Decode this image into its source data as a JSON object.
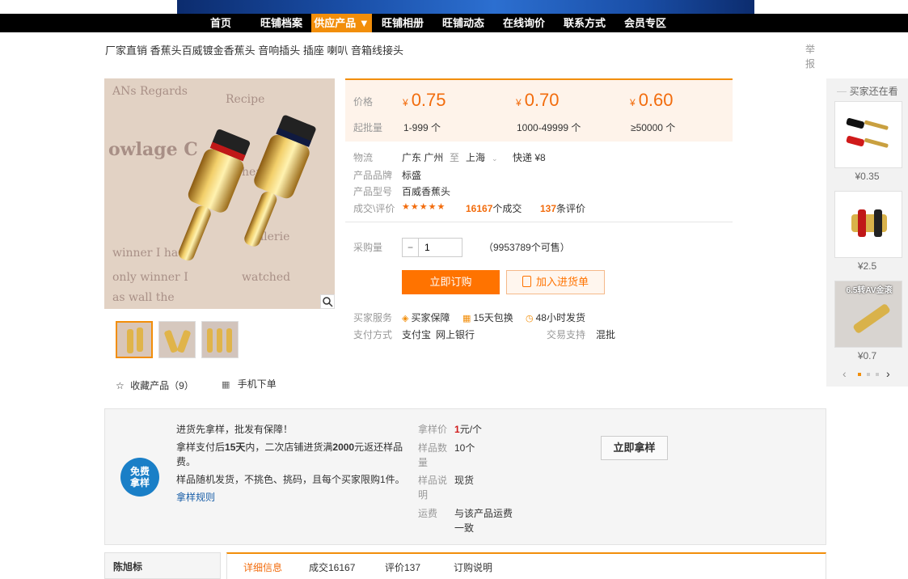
{
  "nav": {
    "items": [
      {
        "label": "首页"
      },
      {
        "label": "旺铺档案"
      },
      {
        "label": "供应产品 ▼"
      },
      {
        "label": "旺铺相册"
      },
      {
        "label": "旺铺动态"
      },
      {
        "label": "在线询价"
      },
      {
        "label": "联系方式"
      },
      {
        "label": "会员专区"
      }
    ],
    "active_index": 2,
    "active_color": "#f28e0a"
  },
  "product": {
    "title": "厂家直销 香蕉头百威镀金香蕉头 音响插头 插座 喇叭 音箱线接头",
    "report_label": "举报"
  },
  "pricing": {
    "price_label": "价格",
    "moq_label": "起批量",
    "currency": "¥",
    "tiers": [
      {
        "price": "0.75",
        "qty": "1-999 个"
      },
      {
        "price": "0.70",
        "qty": "1000-49999 个"
      },
      {
        "price": "0.60",
        "qty": "≥50000 个"
      }
    ],
    "price_color": "#f26c0d"
  },
  "details": {
    "logistics_label": "物流",
    "origin": "广东 广州",
    "to_word": "至",
    "destination": "上海",
    "shipping": "快递 ¥8",
    "brand_label": "产品品牌",
    "brand": "标盛",
    "model_label": "产品型号",
    "model": "百威香蕉头",
    "deals_label": "成交\\评价",
    "stars": "★★★★★",
    "deal_count": "16167",
    "deal_suffix": "个成交",
    "review_count": "137",
    "review_suffix": "条评价"
  },
  "purchase": {
    "qty_label": "采购量",
    "qty_value": "1",
    "available": "（9953789个可售）",
    "buy_now": "立即订购",
    "add_to_cart": "加入进货单"
  },
  "services": {
    "buyer_service_label": "买家服务",
    "items": [
      "买家保障",
      "15天包换",
      "48小时发货"
    ],
    "payment_label": "支付方式",
    "payments": [
      "支付宝",
      "网上银行"
    ],
    "trade_support_label": "交易支持",
    "trade_support": "混批"
  },
  "gallery": {
    "favorite_label": "收藏产品（9）",
    "mobile_label": "手机下单"
  },
  "also_viewed": {
    "header": "买家还在看",
    "items": [
      {
        "price": "¥0.35"
      },
      {
        "price": "¥2.5"
      },
      {
        "price": "¥0.7",
        "caption": "6.5转AV金滚"
      }
    ]
  },
  "sample": {
    "badge": "免费拿样",
    "headline": "进货先拿样，批发有保障！",
    "line2_a": "拿样支付后",
    "line2_b": "15天",
    "line2_c": "内，二次店铺进货满",
    "line2_d": "2000",
    "line2_e": "元返还样品费。",
    "line3": "样品随机发货，不挑色、挑码，且每个买家限购1件。",
    "rules_link": "拿样规则",
    "price_label": "拿样价",
    "price_num": "1",
    "price_unit": "元/个",
    "count_label": "样品数量",
    "count": "10个",
    "desc_label": "样品说明",
    "desc": "现货",
    "freight_label": "运费",
    "freight": "与该产品运费一致",
    "button": "立即拿样"
  },
  "bottom": {
    "shop_name": "陈旭标",
    "tabs": [
      "详细信息",
      "成交16167",
      "评价137",
      "订购说明"
    ]
  }
}
